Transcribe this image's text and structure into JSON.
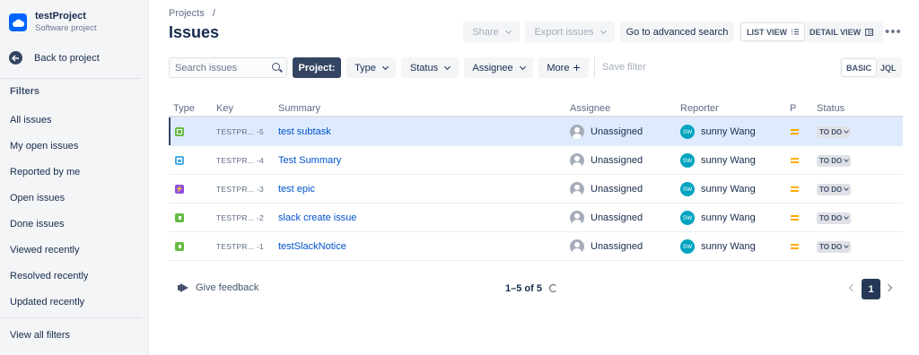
{
  "project": {
    "name": "testProject",
    "type": "Software project",
    "icon": "cloud-icon"
  },
  "sidebar": {
    "back_label": "Back to project",
    "filters_title": "Filters",
    "items": [
      "All issues",
      "My open issues",
      "Reported by me",
      "Open issues",
      "Done issues",
      "Viewed recently",
      "Resolved recently",
      "Updated recently"
    ],
    "view_all": "View all filters"
  },
  "header": {
    "breadcrumb": "Projects",
    "breadcrumb_sep": "/",
    "title": "Issues",
    "share_label": "Share",
    "export_label": "Export issues",
    "advanced_label": "Go to advanced search",
    "list_view_label": "LIST VIEW",
    "detail_view_label": "DETAIL VIEW",
    "more_label": "•••"
  },
  "filterbar": {
    "search_placeholder": "Search issues",
    "project_label": "Project:",
    "type_label": "Type",
    "status_label": "Status",
    "assignee_label": "Assignee",
    "more_label": "More",
    "more_plus": "+",
    "save_filter_label": "Save filter",
    "basic_label": "BASIC",
    "jql_label": "JQL"
  },
  "table": {
    "columns": {
      "type": "Type",
      "key": "Key",
      "summary": "Summary",
      "assignee": "Assignee",
      "reporter": "Reporter",
      "priority": "P",
      "status": "Status"
    },
    "rows": [
      {
        "type": "subtask",
        "key_prefix": "TESTPR...",
        "key_num": "-5",
        "summary": "test subtask",
        "assignee": "Unassigned",
        "reporter_initials": "SW",
        "reporter": "sunny Wang",
        "status": "TO DO",
        "selected": true
      },
      {
        "type": "task",
        "key_prefix": "TESTPR...",
        "key_num": "-4",
        "summary": "Test Summary",
        "assignee": "Unassigned",
        "reporter_initials": "SW",
        "reporter": "sunny Wang",
        "status": "TO DO",
        "selected": false
      },
      {
        "type": "epic",
        "key_prefix": "TESTPR...",
        "key_num": "-3",
        "summary": "test epic",
        "assignee": "Unassigned",
        "reporter_initials": "SW",
        "reporter": "sunny Wang",
        "status": "TO DO",
        "selected": false
      },
      {
        "type": "story",
        "key_prefix": "TESTPR...",
        "key_num": "-2",
        "summary": "slack create issue",
        "assignee": "Unassigned",
        "reporter_initials": "SW",
        "reporter": "sunny Wang",
        "status": "TO DO",
        "selected": false
      },
      {
        "type": "story",
        "key_prefix": "TESTPR...",
        "key_num": "-1",
        "summary": "testSlackNotice",
        "assignee": "Unassigned",
        "reporter_initials": "SW",
        "reporter": "sunny Wang",
        "status": "TO DO",
        "selected": false
      }
    ]
  },
  "footer": {
    "feedback_label": "Give feedback",
    "count_label": "1–5 of 5",
    "current_page": "1"
  },
  "colors": {
    "accent": "#0052cc",
    "dark_button": "#344563",
    "selected_row": "#deebff",
    "priority_medium": "#ffab00",
    "reporter_avatar": "#00a3bf"
  }
}
